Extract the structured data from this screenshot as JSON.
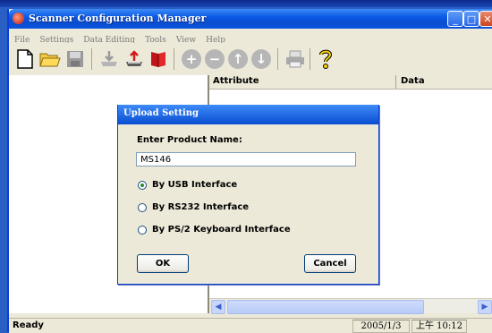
{
  "window": {
    "title": "Scanner Configuration Manager",
    "controls": [
      "_",
      "□",
      "✕"
    ]
  },
  "menu": [
    "File",
    "Settings",
    "Data Editing",
    "Tools",
    "View",
    "Help"
  ],
  "toolbar": {
    "items": [
      "new-icon",
      "open-icon",
      "save-icon",
      "download-icon",
      "upload-icon",
      "book-icon",
      "add-icon",
      "remove-icon",
      "move-up-icon",
      "move-down-icon",
      "print-icon",
      "help-icon"
    ]
  },
  "grid": {
    "columns": [
      "Attribute",
      "Data"
    ]
  },
  "status": {
    "text": "Ready",
    "date": "2005/1/3",
    "time": "上午 10:12"
  },
  "dialog": {
    "title": "Upload Setting",
    "label": "Enter Product Name:",
    "input_value": "MS146",
    "options": [
      {
        "label": "By USB Interface",
        "selected": true
      },
      {
        "label": "By RS232 Interface",
        "selected": false
      },
      {
        "label": "By PS/2 Keyboard Interface",
        "selected": false
      }
    ],
    "ok": "OK",
    "cancel": "Cancel"
  },
  "colors": {
    "titlebar": "#0b5ae6",
    "face": "#ece9d8",
    "accent": "#0a3fd6"
  }
}
